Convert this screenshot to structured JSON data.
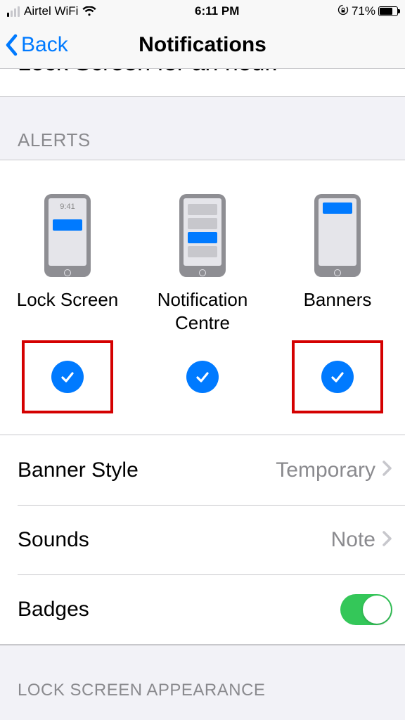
{
  "status": {
    "carrier": "Airtel WiFi",
    "time": "6:11 PM",
    "battery_pct": "71%"
  },
  "nav": {
    "back_label": "Back",
    "title": "Notifications"
  },
  "partial_row": "Lock Screen for an hour.",
  "sections": {
    "alerts_header": "ALERTS",
    "lock_appearance_header": "LOCK SCREEN APPEARANCE"
  },
  "alerts": {
    "lock_screen": {
      "label": "Lock Screen",
      "preview_time": "9:41",
      "checked": true,
      "highlighted": true
    },
    "notification_centre": {
      "label": "Notification\nCentre",
      "checked": true,
      "highlighted": false
    },
    "banners": {
      "label": "Banners",
      "checked": true,
      "highlighted": true
    }
  },
  "rows": {
    "banner_style": {
      "label": "Banner Style",
      "value": "Temporary"
    },
    "sounds": {
      "label": "Sounds",
      "value": "Note"
    },
    "badges": {
      "label": "Badges",
      "on": true
    }
  }
}
